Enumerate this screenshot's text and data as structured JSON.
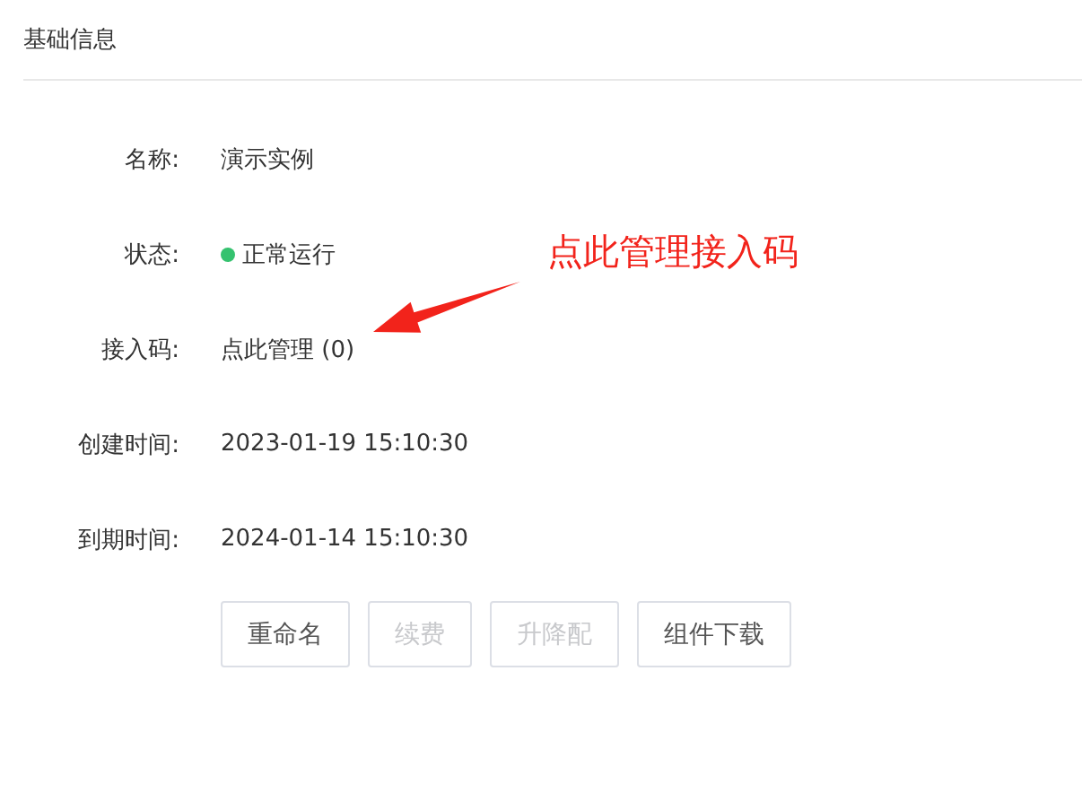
{
  "section": {
    "title": "基础信息"
  },
  "fields": [
    {
      "kind": "text",
      "label": "名称:",
      "value": "演示实例"
    },
    {
      "kind": "status",
      "label": "状态:",
      "value": "正常运行",
      "color": "#35c26f"
    },
    {
      "kind": "link",
      "label": "接入码:",
      "value": "点此管理 (0)"
    },
    {
      "kind": "text",
      "label": "创建时间:",
      "value": "2023-01-19 15:10:30"
    },
    {
      "kind": "text",
      "label": "到期时间:",
      "value": "2024-01-14 15:10:30"
    }
  ],
  "buttons": [
    {
      "label": "重命名",
      "disabled": false
    },
    {
      "label": "续费",
      "disabled": true
    },
    {
      "label": "升降配",
      "disabled": true
    },
    {
      "label": "组件下载",
      "disabled": false
    }
  ],
  "annotation": {
    "text": "点此管理接入码"
  }
}
